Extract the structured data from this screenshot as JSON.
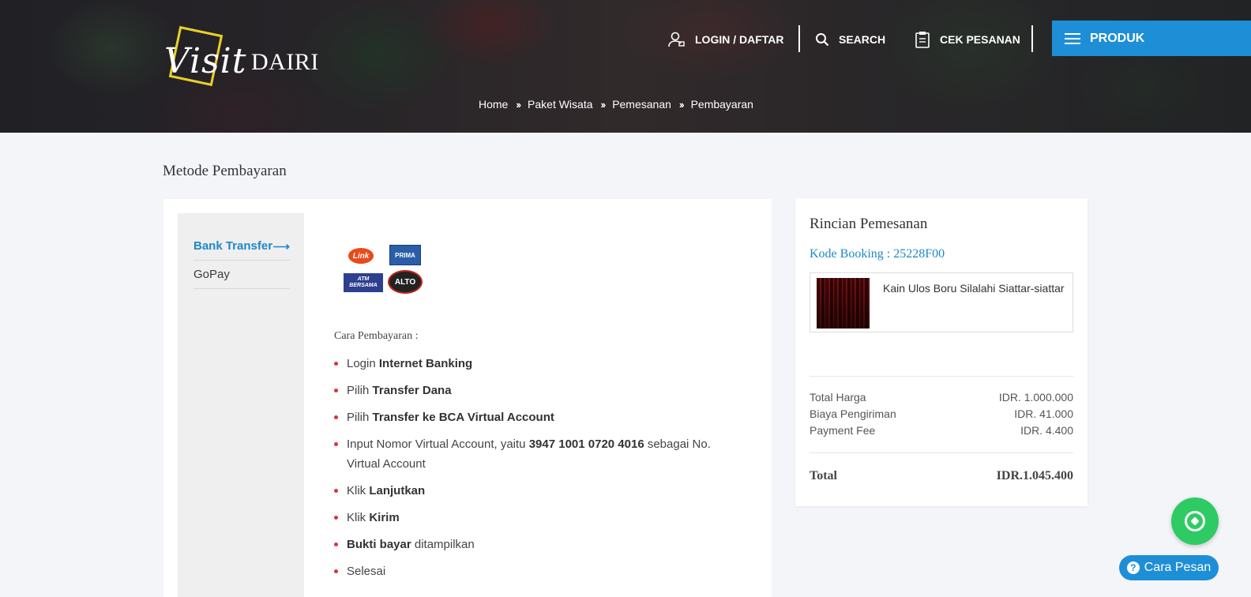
{
  "header": {
    "logo_script": "Visit",
    "logo_text": "DAIRI",
    "nav": {
      "login": "LOGIN / DAFTAR",
      "search": "SEARCH",
      "cek_pesanan": "CEK PESANAN",
      "produk": "PRODUK"
    }
  },
  "breadcrumb": [
    "Home",
    "Paket Wisata",
    "Pemesanan",
    "Pembayaran"
  ],
  "page": {
    "title": "Metode Pembayaran"
  },
  "payment": {
    "methods": [
      {
        "label": "Bank Transfer",
        "active": true
      },
      {
        "label": "GoPay",
        "active": false
      }
    ],
    "bank_logos": [
      "Link",
      "PRIMA",
      "ATM BERSAMA",
      "ALTO"
    ],
    "instructions_title": "Cara Pembayaran :",
    "steps": [
      {
        "pre": "Login ",
        "bold": "Internet Banking",
        "post": ""
      },
      {
        "pre": "Pilih ",
        "bold": "Transfer Dana",
        "post": ""
      },
      {
        "pre": "Pilih ",
        "bold": "Transfer ke BCA Virtual Account",
        "post": ""
      },
      {
        "pre": "Input Nomor Virtual Account, yaitu ",
        "bold": "3947 1001 0720 4016",
        "post": " sebagai No. Virtual Account"
      },
      {
        "pre": "Klik ",
        "bold": "Lanjutkan",
        "post": ""
      },
      {
        "pre": "Klik ",
        "bold": "Kirim",
        "post": ""
      },
      {
        "pre": "",
        "bold": "Bukti bayar",
        "post": " ditampilkan"
      },
      {
        "pre": "Selesai",
        "bold": "",
        "post": ""
      }
    ]
  },
  "summary": {
    "title": "Rincian Pemesanan",
    "booking_code": "Kode Booking : 25228F00",
    "product_name": "Kain Ulos Boru Silalahi Siattar-siattar",
    "rows": [
      {
        "label": "Total Harga",
        "value": "IDR. 1.000.000"
      },
      {
        "label": "Biaya Pengiriman",
        "value": "IDR. 41.000"
      },
      {
        "label": "Payment Fee",
        "value": "IDR. 4.400"
      }
    ],
    "total_label": "Total",
    "total_value": "IDR.1.045.400"
  },
  "floating": {
    "cara_pesan": "Cara Pesan"
  },
  "colors": {
    "accent": "#1e8fd6",
    "bullet": "#d9333f",
    "whatsapp": "#2ecb65",
    "page_bg": "#f4f5f9"
  }
}
